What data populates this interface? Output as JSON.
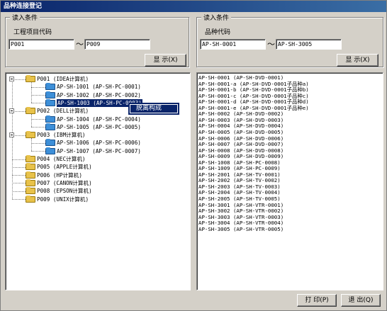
{
  "window": {
    "title": "品种连接登记"
  },
  "left_condition": {
    "group_title": "读入条件",
    "label": "工程项目代码",
    "from_value": "P001",
    "to_value": "P009",
    "separator": "～",
    "show_button": "显  示(X)"
  },
  "right_condition": {
    "group_title": "读入条件",
    "label": "品种代码",
    "from_value": "AP-SH-0001",
    "to_value": "AP-SH-3005",
    "separator": "～",
    "show_button": "显  示(X)"
  },
  "tree": {
    "nodes": [
      {
        "text": "P001   (IDEA计算机)",
        "level": 0,
        "expanded": true
      },
      {
        "text": "AP-SH-1001  (AP-SH-PC-0001)",
        "level": 1
      },
      {
        "text": "AP-SH-1002  (AP-SH-PC-0002)",
        "level": 1
      },
      {
        "text": "AP-SH-1003  (AP-SH-PC-0003)",
        "level": 1,
        "selected": true
      },
      {
        "text": "P002   (DELL计算机)",
        "level": 0,
        "expanded": true
      },
      {
        "text": "AP-SH-1004  (AP-SH-PC-0004)",
        "level": 1
      },
      {
        "text": "AP-SH-1005  (AP-SH-PC-0005)",
        "level": 1
      },
      {
        "text": "P003   (IBM计算机)",
        "level": 0,
        "expanded": true
      },
      {
        "text": "AP-SH-1006  (AP-SH-PC-0006)",
        "level": 1
      },
      {
        "text": "AP-SH-1007  (AP-SH-PC-0007)",
        "level": 1
      },
      {
        "text": "P004   (NEC计算机)",
        "level": 0
      },
      {
        "text": "P005   (APPLE计算机)",
        "level": 0
      },
      {
        "text": "P006   (HP计算机)",
        "level": 0
      },
      {
        "text": "P007   (CANON计算机)",
        "level": 0
      },
      {
        "text": "P008   (EPSON计算机)",
        "level": 0
      },
      {
        "text": "P009   (UNIX计算机)",
        "level": 0
      }
    ]
  },
  "context_menu": {
    "item": "脱离构成"
  },
  "product_list": [
    "AP-SH-0001   (AP-SH-DVD-0001)",
    "AP-SH-0001-a   (AP-SH-DVD-0001子品种a)",
    "AP-SH-0001-b   (AP-SH-DVD-0001子品种b)",
    "AP-SH-0001-c   (AP-SH-DVD-0001子品种c)",
    "AP-SH-0001-d   (AP-SH-DVD-0001子品种d)",
    "AP-SH-0001-e   (AP-SH-DVD-0001子品种e)",
    "AP-SH-0002   (AP-SH-DVD-0002)",
    "AP-SH-0003   (AP-SH-DVD-0003)",
    "AP-SH-0004   (AP-SH-DVD-0004)",
    "AP-SH-0005   (AP-SH-DVD-0005)",
    "AP-SH-0006   (AP-SH-DVD-0006)",
    "AP-SH-0007   (AP-SH-DVD-0007)",
    "AP-SH-0008   (AP-SH-DVD-0008)",
    "AP-SH-0009   (AP-SH-DVD-0009)",
    "AP-SH-1008   (AP-SH-PC-0008)",
    "AP-SH-1009   (AP-SH-PC-0009)",
    "AP-SH-2001   (AP-SH-TV-0001)",
    "AP-SH-2002   (AP-SH-TV-0002)",
    "AP-SH-2003   (AP-SH-TV-0003)",
    "AP-SH-2004   (AP-SH-TV-0004)",
    "AP-SH-2005   (AP-SH-TV-0005)",
    "AP-SH-3001   (AP-SH-VTR-0001)",
    "AP-SH-3002   (AP-SH-VTR-0002)",
    "AP-SH-3003   (AP-SH-VTR-0003)",
    "AP-SH-3004   (AP-SH-VTR-0004)",
    "AP-SH-3005   (AP-SH-VTR-0005)"
  ],
  "footer": {
    "print_button": "打  印(P)",
    "exit_button": "退  出(Q)"
  }
}
